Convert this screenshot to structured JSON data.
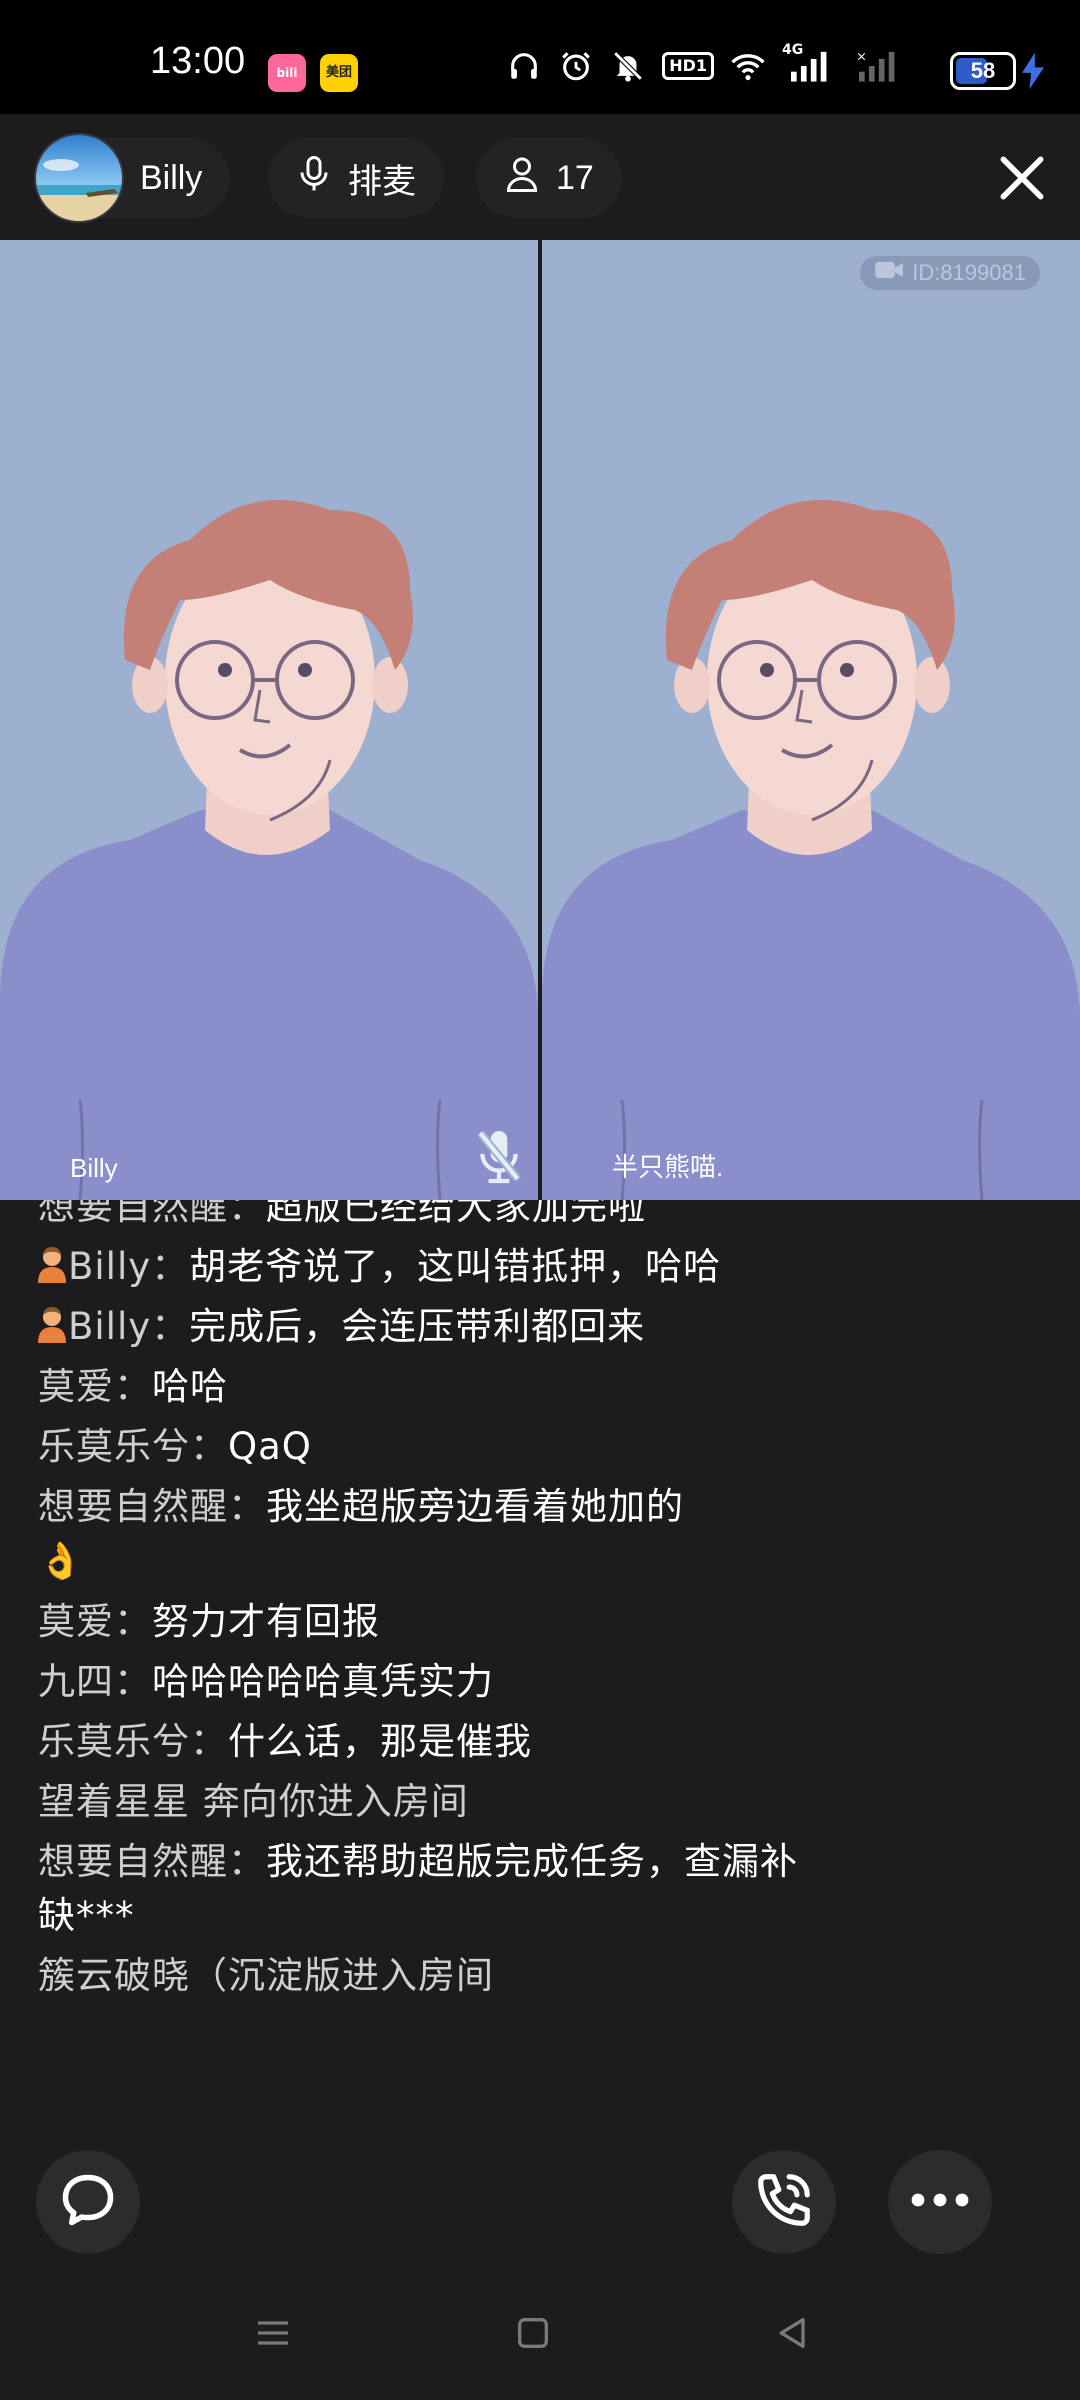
{
  "status_bar": {
    "time": "13:00",
    "apps": [
      {
        "name": "bilibili-icon",
        "label": "bili",
        "color": "#ff6699"
      },
      {
        "name": "meituan-icon",
        "label": "美团",
        "color": "#ffd100"
      }
    ],
    "hd_label": "HD1",
    "network_label": "4G",
    "battery_level": "58",
    "charging": true
  },
  "header": {
    "host_name": "Billy",
    "mic_queue_label": "排麦",
    "viewer_count": "17"
  },
  "videos": {
    "room_id": "ID:8199081",
    "tiles": [
      {
        "name": "Billy",
        "muted": true
      },
      {
        "name": "半只熊喵.",
        "muted": false
      }
    ]
  },
  "chat": {
    "messages": [
      {
        "nick": "想要自然醒：",
        "text": "超版已经给大家加完啦",
        "emoji": ""
      },
      {
        "nick": "Billy：",
        "text": "胡老爷说了，这叫错抵押，哈哈",
        "emoji": "host"
      },
      {
        "nick": "Billy：",
        "text": "完成后，会连压带利都回来",
        "emoji": "host"
      },
      {
        "nick": "莫爱：",
        "text": "哈哈",
        "emoji": ""
      },
      {
        "nick": "乐莫乐兮：",
        "text": "QaQ",
        "emoji": ""
      },
      {
        "nick": "想要自然醒：",
        "text": "我坐超版旁边看着她加的",
        "emoji": "",
        "trailing_emoji": "👌"
      },
      {
        "nick": "莫爱：",
        "text": "努力才有回报",
        "emoji": ""
      },
      {
        "nick": "九四：",
        "text": "哈哈哈哈哈真凭实力",
        "emoji": ""
      },
      {
        "nick": "乐莫乐兮：",
        "text": "什么话，那是催我",
        "emoji": ""
      },
      {
        "system": "望着星星 奔向你进入房间"
      },
      {
        "nick": "想要自然醒：",
        "text": "我还帮助超版完成任务，查漏补缺***",
        "emoji": ""
      },
      {
        "system": "簇云破晓（沉淀版进入房间"
      }
    ]
  },
  "controls": {
    "chat_icon": "chat-bubble-icon",
    "call_icon": "phone-call-icon",
    "more_icon": "more-icon"
  },
  "colors": {
    "background": "#1c1c1e",
    "video_bg": "#9db0cf",
    "battery_accent": "#2d5cc9"
  }
}
